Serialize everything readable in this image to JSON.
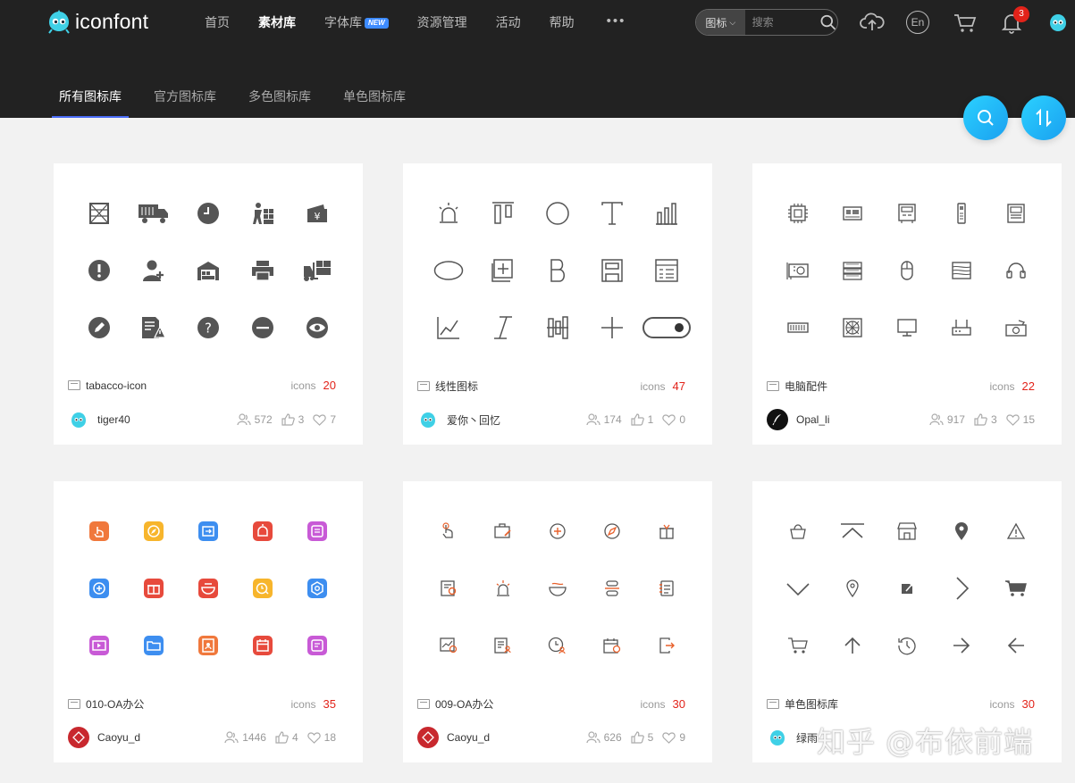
{
  "header": {
    "brand": "iconfont",
    "nav": [
      {
        "label": "首页",
        "active": false
      },
      {
        "label": "素材库",
        "active": true
      },
      {
        "label": "字体库",
        "active": false,
        "badge": "NEW"
      },
      {
        "label": "资源管理",
        "active": false
      },
      {
        "label": "活动",
        "active": false
      },
      {
        "label": "帮助",
        "active": false
      }
    ],
    "more": "•••",
    "search": {
      "type": "图标",
      "placeholder": "搜索"
    },
    "lang": "En",
    "notifications": "3"
  },
  "subtabs": [
    {
      "label": "所有图标库",
      "active": true
    },
    {
      "label": "官方图标库",
      "active": false
    },
    {
      "label": "多色图标库",
      "active": false
    },
    {
      "label": "单色图标库",
      "active": false
    }
  ],
  "cards": [
    {
      "title": "tabacco-icon",
      "icons_label": "icons",
      "count": "20",
      "author": "tiger40",
      "views": "572",
      "likes": "3",
      "favs": "7",
      "style": "dark-gray"
    },
    {
      "title": "线性图标",
      "icons_label": "icons",
      "count": "47",
      "author": "爱你丶回忆",
      "views": "174",
      "likes": "1",
      "favs": "0",
      "style": "line"
    },
    {
      "title": "电脑配件",
      "icons_label": "icons",
      "count": "22",
      "author": "Opal_li",
      "views": "917",
      "likes": "3",
      "favs": "15",
      "style": "thin-line"
    },
    {
      "title": "010-OA办公",
      "icons_label": "icons",
      "count": "35",
      "author": "Caoyu_d",
      "views": "1446",
      "likes": "4",
      "favs": "18",
      "style": "multicolor"
    },
    {
      "title": "009-OA办公",
      "icons_label": "icons",
      "count": "30",
      "author": "Caoyu_d",
      "views": "626",
      "likes": "5",
      "favs": "9",
      "style": "orange-line"
    },
    {
      "title": "单色图标库",
      "icons_label": "icons",
      "count": "30",
      "author": "绿雨",
      "views": "",
      "likes": "",
      "favs": "",
      "style": "mono"
    }
  ],
  "colors": {
    "accent_red": "#e2231a",
    "header_bg": "#222222",
    "float_btn": "#1aa0f0"
  },
  "watermark": "知乎 @布依前端"
}
